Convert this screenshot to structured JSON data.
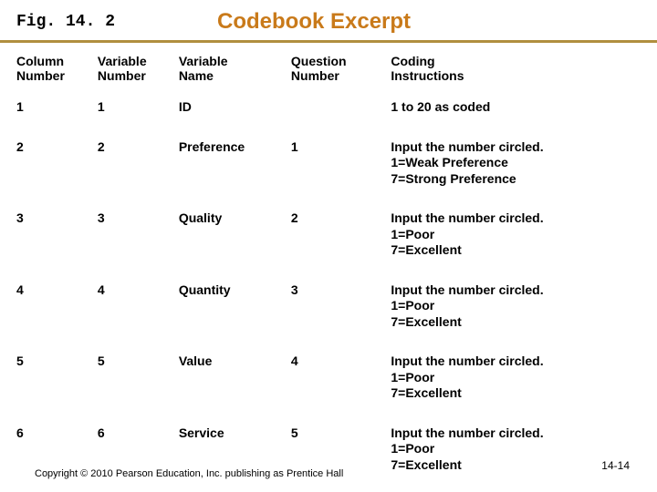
{
  "header": {
    "figure_label": "Fig. 14. 2",
    "title": "Codebook Excerpt"
  },
  "table": {
    "headers": {
      "col1": "Column\nNumber",
      "col2": "Variable\nNumber",
      "col3": "Variable\nName",
      "col4": "Question\nNumber",
      "col5": "Coding\nInstructions"
    },
    "rows": [
      {
        "col1": "1",
        "col2": "1",
        "col3": "ID",
        "col4": "",
        "col5": "1 to 20 as coded"
      },
      {
        "col1": "2",
        "col2": "2",
        "col3": "Preference",
        "col4": "1",
        "col5": "Input the number circled.\n1=Weak Preference\n7=Strong Preference"
      },
      {
        "col1": "3",
        "col2": "3",
        "col3": "Quality",
        "col4": "2",
        "col5": "Input the number circled.\n1=Poor\n7=Excellent"
      },
      {
        "col1": "4",
        "col2": "4",
        "col3": "Quantity",
        "col4": "3",
        "col5": "Input the number circled.\n1=Poor\n7=Excellent"
      },
      {
        "col1": "5",
        "col2": "5",
        "col3": "Value",
        "col4": "4",
        "col5": "Input the number circled.\n1=Poor\n7=Excellent"
      },
      {
        "col1": "6",
        "col2": "6",
        "col3": "Service",
        "col4": "5",
        "col5": "Input the number circled.\n1=Poor\n7=Excellent"
      }
    ]
  },
  "footer": {
    "copyright": "Copyright © 2010 Pearson Education, Inc. publishing as Prentice Hall",
    "page_number": "14-14"
  }
}
